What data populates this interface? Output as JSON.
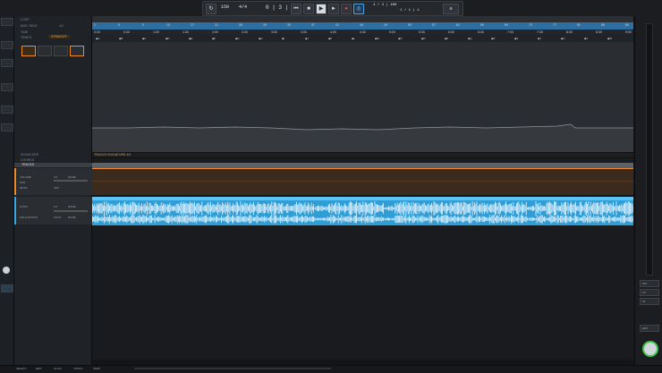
{
  "transport": {
    "tempo": "150",
    "time_sig": "4/4",
    "position": "0 | 3 | 959",
    "lcd_left": "4 / 4 | 466",
    "lcd_right": "1 / 1 | 1"
  },
  "inspector": {
    "loop_label": "LOOP",
    "bar_beat": "BAR / BEAT",
    "sig": "4/4",
    "time_label": "TIME",
    "tempo_label": "TEMPO",
    "tempo_mode": "STRAIGHT",
    "signature_label": "SIGNATURE",
    "chords_label": "CHORDS",
    "tracks_label": "TRACKS",
    "folder": {
      "volume": "VOLUME",
      "vol_val": "0.0",
      "pan": "PAN",
      "pan_val": "NONE",
      "mute": "MUTE",
      "off": "OFF"
    },
    "audio": {
      "clip": "CLIPS",
      "vol": "0.0",
      "pan": "NONE",
      "follow": "FOLLOW POS",
      "auto": "AUTO",
      "none": "NONE"
    }
  },
  "timeline": {
    "bars": [
      "1",
      "5",
      "9",
      "13",
      "17",
      "21",
      "25",
      "29",
      "33",
      "37",
      "41",
      "45",
      "49",
      "53",
      "57",
      "61",
      "65",
      "69",
      "73",
      "77",
      "81",
      "85",
      "89"
    ],
    "times": [
      "0:00",
      "0:30",
      "1:00",
      "1:30",
      "2:00",
      "2:30",
      "3:00",
      "3:30",
      "4:00",
      "4:30",
      "5:00",
      "5:30",
      "6:00",
      "6:30",
      "7:00",
      "7:30",
      "8:00",
      "8:30",
      "9:00"
    ],
    "markers": [
      "A",
      "B",
      "C",
      "D",
      "E",
      "F",
      "G",
      "H",
      "I",
      "J",
      "K",
      "L",
      "M",
      "N",
      "O",
      "P",
      "Q",
      "R",
      "S",
      "T",
      "U",
      "V",
      "W"
    ],
    "signature_text": "TRACKS SIGNATURE 4/4",
    "clip_name": "Audio"
  },
  "right_panel": {
    "btns": [
      "MIX",
      "FX",
      "IO",
      "EDIT"
    ]
  },
  "bottom": {
    "items": [
      "SELECT",
      "EDIT",
      "CLICK",
      "TOOLS",
      "SNAP"
    ]
  },
  "colors": {
    "accent_blue": "#2f9ed6",
    "accent_orange": "#f08a24"
  }
}
